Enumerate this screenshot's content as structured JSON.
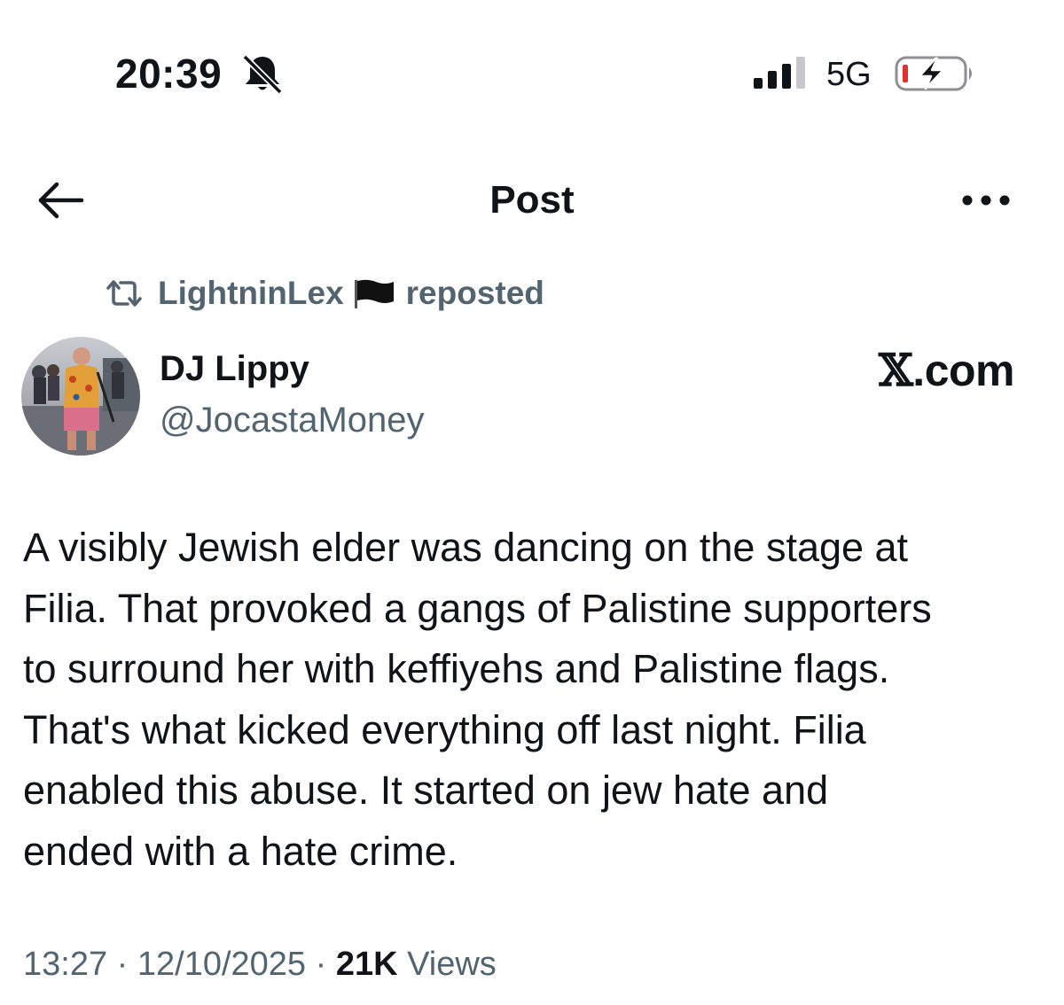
{
  "status_bar": {
    "time": "20:39",
    "network": "5G",
    "icons": [
      "bell-off-icon",
      "signal-icon",
      "battery-charging-icon"
    ],
    "battery_color": "#e0322e"
  },
  "header": {
    "title": "Post",
    "back_icon": "arrow-left-icon",
    "more_icon": "ellipsis-icon"
  },
  "repost": {
    "user": "LightninLex",
    "label": "reposted",
    "icons": [
      "repost-icon",
      "black-flag-icon"
    ]
  },
  "tweet": {
    "author_name": "DJ Lippy",
    "author_handle": "@JocastaMoney",
    "source_x": "𝕏",
    "source_rest": ".com",
    "text_lines": [
      "A visibly Jewish elder was dancing on the stage at",
      "Filia. That provoked a gangs of Palistine supporters",
      "to surround her with keffiyehs and Palistine flags.",
      "That's what kicked everything off last night. Filia",
      "enabled this abuse. It started on jew hate and",
      "ended with a hate crime."
    ],
    "time": "13:27",
    "separator": "·",
    "date": "12/10/2025",
    "views_count": "21K",
    "views_label": "Views"
  },
  "colors": {
    "text_primary": "#0f1419",
    "text_secondary": "#536471",
    "background": "#ffffff"
  }
}
